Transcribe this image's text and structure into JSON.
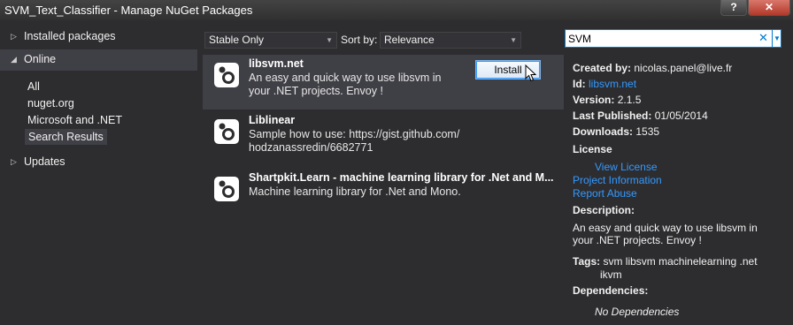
{
  "window": {
    "title": "SVM_Text_Classifier - Manage NuGet Packages",
    "help": "?",
    "close": "✕"
  },
  "nav": {
    "installed": "Installed packages",
    "online": "Online",
    "online_items": [
      "All",
      "nuget.org",
      "Microsoft and .NET",
      "Search Results"
    ],
    "updates": "Updates"
  },
  "filter": {
    "stability": "Stable Only",
    "sort_label": "Sort by:",
    "sort_value": "Relevance"
  },
  "search": {
    "value": "SVM"
  },
  "packages": [
    {
      "name": "libsvm.net",
      "desc1": "An easy and quick way to use libsvm in",
      "desc2": "your .NET projects. Envoy !",
      "action": "Install"
    },
    {
      "name": "Liblinear",
      "desc1": "Sample how to use: https://gist.github.com/",
      "desc2": "hodzanassredin/6682771"
    },
    {
      "name": "Shartpkit.Learn - machine learning library for .Net and M...",
      "desc1": "Machine learning library for .Net and Mono."
    }
  ],
  "details": {
    "created_label": "Created by:",
    "created": "nicolas.panel@live.fr",
    "id_label": "Id:",
    "id": "libsvm.net",
    "version_label": "Version:",
    "version": "2.1.5",
    "published_label": "Last Published:",
    "published": "01/05/2014",
    "downloads_label": "Downloads:",
    "downloads": "1535",
    "license_label": "License",
    "view_license": "View License",
    "project_info": "Project Information",
    "report_abuse": "Report Abuse",
    "description_label": "Description:",
    "description1": "An easy and quick way to use libsvm in",
    "description2": "your .NET projects. Envoy !",
    "tags_label": "Tags:",
    "tags1": "svm libsvm machinelearning .net",
    "tags2": "ikvm",
    "dependencies_label": "Dependencies:",
    "no_dependencies": "No Dependencies"
  }
}
